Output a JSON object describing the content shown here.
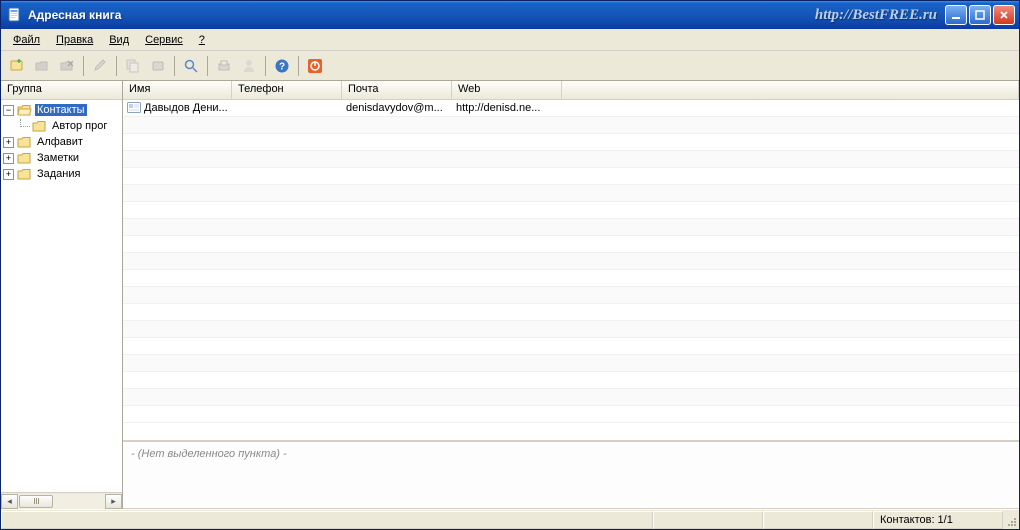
{
  "window": {
    "title": "Адресная книга",
    "watermark": "http://BestFREE.ru"
  },
  "menu": {
    "file": "Файл",
    "edit": "Правка",
    "view": "Вид",
    "service": "Сервис",
    "help": "?"
  },
  "sidebar": {
    "header": "Группа",
    "contacts": "Контакты",
    "contacts_child": "Автор прог",
    "alphabet": "Алфавит",
    "notes": "Заметки",
    "tasks": "Задания"
  },
  "grid": {
    "col_name": "Имя",
    "col_phone": "Телефон",
    "col_email": "Почта",
    "col_web": "Web",
    "rows": [
      {
        "name": "Давыдов Дени...",
        "phone": "",
        "email": "denisdavydov@m...",
        "web": "http://denisd.ne..."
      }
    ]
  },
  "details": {
    "empty_text": "- (Нет выделенного пункта) -"
  },
  "status": {
    "count": "Контактов: 1/1"
  }
}
